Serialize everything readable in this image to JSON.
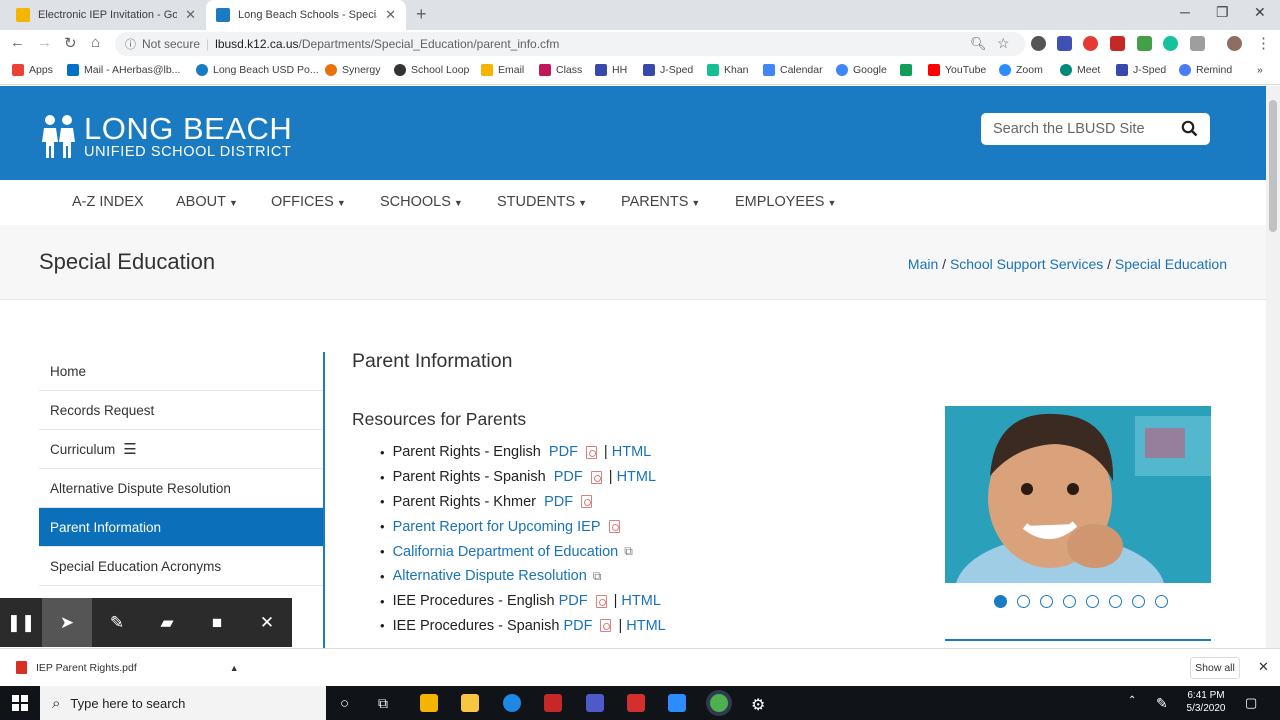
{
  "browser": {
    "tabs": [
      {
        "title": "Electronic IEP Invitation - Google",
        "color": "#f4b400",
        "active": false
      },
      {
        "title": "Long Beach Schools - Special Ed",
        "color": "#1a7bc2",
        "active": true
      }
    ],
    "omnibox": {
      "security": "Not secure",
      "host": "lbusd.k12.ca.us",
      "path": "/Departments/Special_Education/parent_info.cfm"
    },
    "bookmarks": [
      {
        "label": "Apps",
        "color": "#ea4335"
      },
      {
        "label": "Mail - AHerbas@lb...",
        "color": "#0072c6"
      },
      {
        "label": "Long Beach USD Po...",
        "color": "#1a7bc2"
      },
      {
        "label": "Synergy",
        "color": "#e8710a"
      },
      {
        "label": "School Loop",
        "color": "#333333"
      },
      {
        "label": "Email",
        "color": "#f4b400"
      },
      {
        "label": "Class",
        "color": "#c2185b"
      },
      {
        "label": "HH",
        "color": "#3949ab"
      },
      {
        "label": "J-Sped",
        "color": "#3949ab"
      },
      {
        "label": "Khan",
        "color": "#14bf96"
      },
      {
        "label": "Calendar",
        "color": "#4285f4"
      },
      {
        "label": "Google",
        "color": "#4285f4"
      },
      {
        "label": "",
        "color": "#0f9d58"
      },
      {
        "label": "YouTube",
        "color": "#ff0000"
      },
      {
        "label": "Zoom",
        "color": "#2d8cff"
      },
      {
        "label": "Meet",
        "color": "#00897b"
      },
      {
        "label": "J-Sped",
        "color": "#3949ab"
      },
      {
        "label": "Remind",
        "color": "#4a7cf7"
      }
    ]
  },
  "site": {
    "logo_big": "LONG BEACH",
    "logo_small": "UNIFIED SCHOOL DISTRICT",
    "search_placeholder": "Search the LBUSD Site",
    "nav": [
      "A-Z INDEX",
      "ABOUT",
      "OFFICES",
      "SCHOOLS",
      "STUDENTS",
      "PARENTS",
      "EMPLOYEES"
    ],
    "page_title": "Special Education",
    "breadcrumbs": [
      "Main",
      "School Support Services",
      "Special Education"
    ],
    "sidebar": [
      "Home",
      "Records Request",
      "Curriculum",
      "Alternative Dispute Resolution",
      "Parent Information",
      "Special Education Acronyms",
      ""
    ],
    "content_title": "Parent Information",
    "resources_title": "Resources for Parents",
    "resources": [
      {
        "text": "Parent Rights - English",
        "pdf": "PDF",
        "html": "HTML"
      },
      {
        "text": "Parent Rights - Spanish",
        "pdf": "PDF",
        "html": "HTML"
      },
      {
        "text": "Parent Rights - Khmer",
        "pdf": "PDF",
        "html": ""
      },
      {
        "link": "Parent Report for Upcoming IEP",
        "kind": "pdf"
      },
      {
        "link": "California Department of Education",
        "kind": "external"
      },
      {
        "link": "Alternative Dispute Resolution",
        "kind": "external"
      },
      {
        "text": "IEE Procedures - English",
        "pdf": "PDF",
        "html": "HTML"
      },
      {
        "text": "IEE Procedures - Spanish",
        "pdf": "PDF",
        "html": "HTML"
      }
    ],
    "carousel_dots": 8,
    "carousel_active": 0
  },
  "download": {
    "file": "IEP Parent Rights.pdf",
    "show_all": "Show all"
  },
  "taskbar": {
    "search": "Type here to search",
    "time": "6:41 PM",
    "date": "5/3/2020"
  }
}
